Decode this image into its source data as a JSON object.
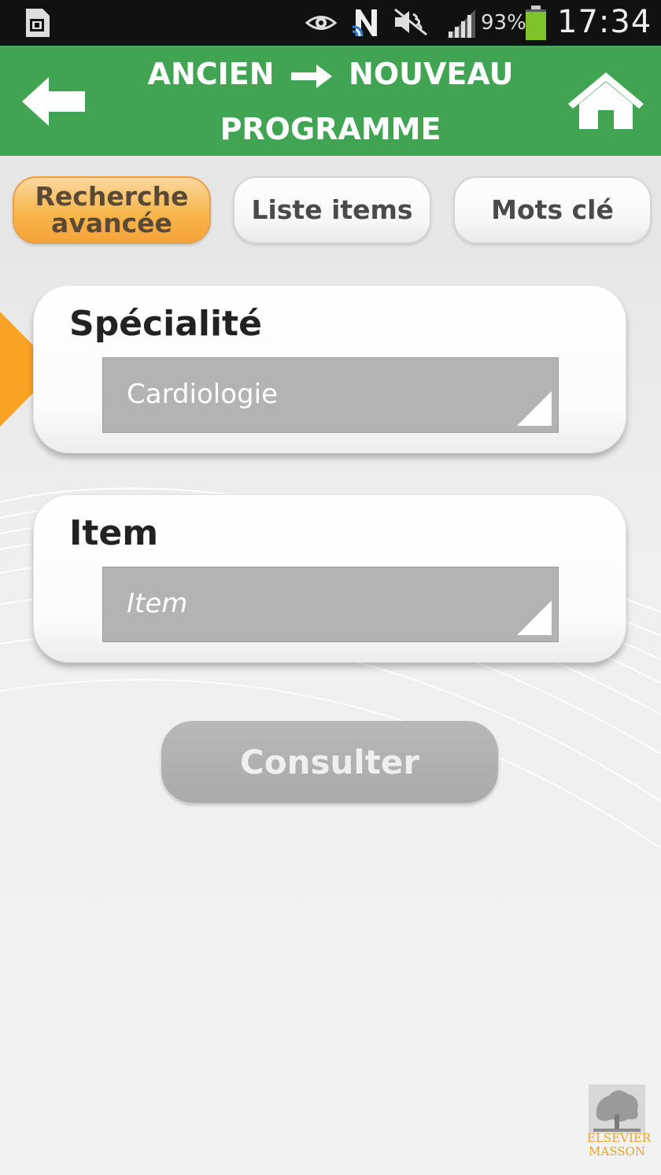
{
  "status_bar": {
    "battery_percent": "93%",
    "time": "17:34",
    "icons": [
      "sim-card-icon",
      "eye-icon",
      "nfc-icon",
      "mute-icon",
      "signal-icon",
      "battery-icon"
    ]
  },
  "header": {
    "title_left": "ANCIEN",
    "title_right": "NOUVEAU",
    "title_line2": "PROGRAMME",
    "color": "#41a452"
  },
  "tabs": [
    {
      "label_line1": "Recherche",
      "label_line2": "avancée",
      "active": true
    },
    {
      "label": "Liste items",
      "active": false
    },
    {
      "label": "Mots clé",
      "active": false
    }
  ],
  "form": {
    "specialite": {
      "label": "Spécialité",
      "value": "Cardiologie"
    },
    "item": {
      "label": "Item",
      "placeholder": "Item"
    }
  },
  "consult_button": {
    "label": "Consulter"
  },
  "logo": {
    "line1": "ELSEVIER",
    "line2": "MASSON"
  },
  "colors": {
    "accent_orange": "#f5a33a",
    "select_gray": "#b3b3b3"
  }
}
